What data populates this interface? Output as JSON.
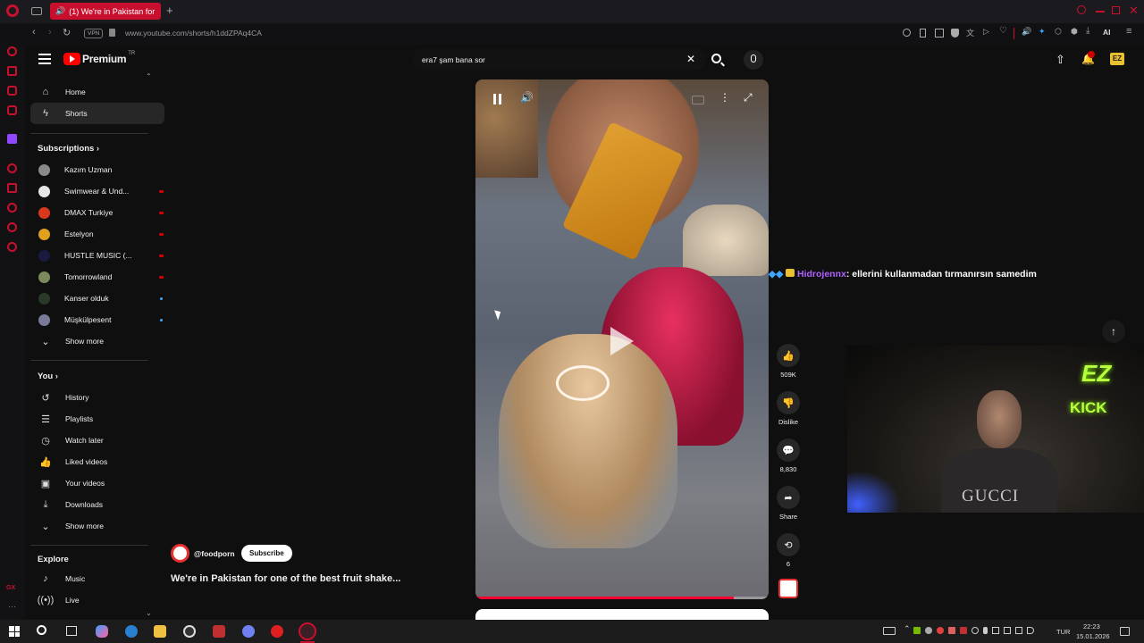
{
  "browser": {
    "tab_title": "(1) We're in Pakistan for",
    "vpn_label": "VPN",
    "url": "www.youtube.com/shorts/h1ddZPAq4CA",
    "ai_label": "AI"
  },
  "youtube": {
    "logo_text": "Premium",
    "logo_sup": "TR",
    "search_query": "era7 şam bana sor",
    "nav": {
      "home": "Home",
      "shorts": "Shorts"
    },
    "subscriptions_title": "Subscriptions",
    "subscriptions": [
      {
        "name": "Kazım Uzman",
        "color": "#8a8a8a"
      },
      {
        "name": "Swimwear & Und...",
        "color": "#e6e6e6"
      },
      {
        "name": "DMAX Turkiye",
        "color": "#d7381e"
      },
      {
        "name": "Estelyon",
        "color": "#e0a020"
      },
      {
        "name": "HUSTLE MUSIC (...",
        "color": "#1a1a40"
      },
      {
        "name": "Tomorrowland",
        "color": "#7a8a5a"
      },
      {
        "name": "Kanser olduk",
        "color": "#2a3a2a"
      },
      {
        "name": "Müşkülpesent",
        "color": "#7a7a9a"
      }
    ],
    "show_more": "Show more",
    "you_title": "You",
    "you_items": [
      "History",
      "Playlists",
      "Watch later",
      "Liked videos",
      "Your videos",
      "Downloads"
    ],
    "explore_title": "Explore",
    "explore_items": [
      "Music",
      "Live"
    ]
  },
  "short": {
    "channel": "@foodporn",
    "subscribe": "Subscribe",
    "title": "We're in Pakistan for one of the best fruit shake...",
    "likes": "509K",
    "dislike": "Dislike",
    "comments": "8,830",
    "share": "Share",
    "remix": "6"
  },
  "chat": {
    "user": "Hidrojennx",
    "message": ": ellerini kullanmadan tırmanırsın samedim"
  },
  "webcam": {
    "logo_top": "EZ",
    "logo_bottom": "KICK",
    "shirt_text": "GUCCI"
  },
  "taskbar": {
    "lang": "TUR",
    "time": "22:23",
    "date": "15.01.2026"
  },
  "icons": [
    "opera-icon",
    "back-icon",
    "forward-icon",
    "reload-icon",
    "lock-icon",
    "menu-icon",
    "youtube-icon",
    "search-icon",
    "mic-icon",
    "close-icon",
    "upload-icon",
    "bell-icon",
    "home-icon",
    "shorts-icon",
    "chevron-icon",
    "history-icon",
    "playlist-icon",
    "clock-icon",
    "like-icon",
    "video-icon",
    "download-icon",
    "music-icon",
    "live-icon",
    "pause-icon",
    "volume-icon",
    "more-icon",
    "fullscreen-icon",
    "dislike-icon",
    "comment-icon",
    "share-icon",
    "remix-icon",
    "arrow-up-icon",
    "windows-icon"
  ]
}
